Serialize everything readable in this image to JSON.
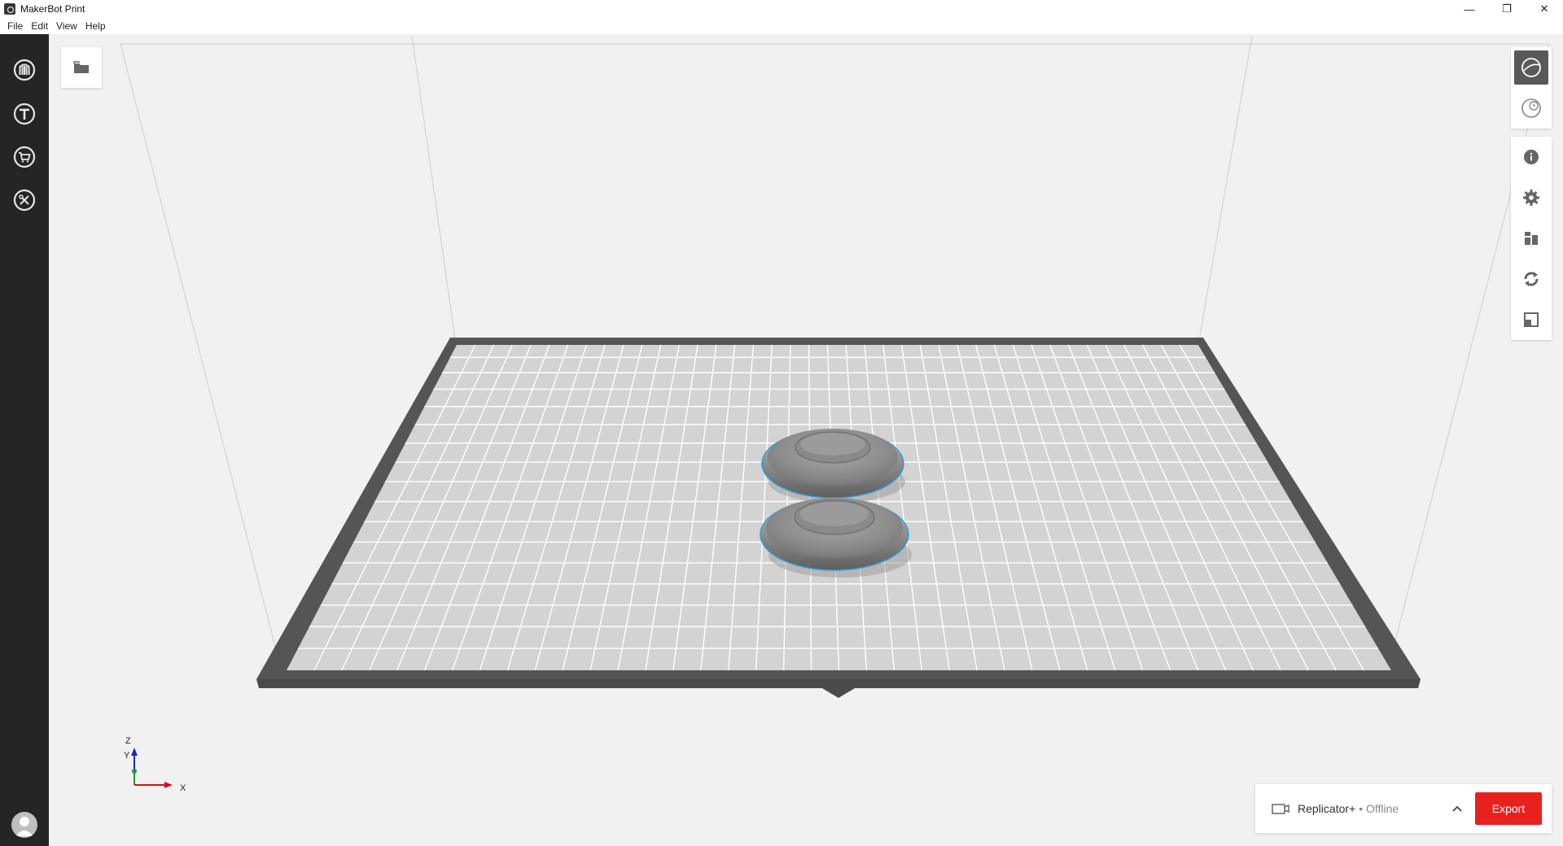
{
  "window": {
    "title": "MakerBot Print",
    "minimize": "—",
    "restore": "❐",
    "close": "✕"
  },
  "menu": [
    "File",
    "Edit",
    "View",
    "Help"
  ],
  "leftnav": [
    "makerbot-logo-icon",
    "thingiverse-icon",
    "store-icon",
    "tools-icon",
    "user-avatar-icon"
  ],
  "right_toolbar": {
    "group1": [
      "prepare-view-icon",
      "preview-clock-icon"
    ],
    "group2": [
      "info-icon",
      "settings-gear-icon",
      "arrange-icon",
      "rotate-icon",
      "scale-icon"
    ]
  },
  "axis": {
    "z": "Z",
    "y": "Y",
    "x": "X"
  },
  "printer": {
    "name": "Replicator+",
    "status": "• Offline",
    "export_label": "Export"
  },
  "colors": {
    "accent": "#e8211f",
    "nav_bg": "#252525",
    "selection_outline": "#2f9bd6",
    "plate_frame": "#555555",
    "plate_surface": "#d3d3d3"
  }
}
